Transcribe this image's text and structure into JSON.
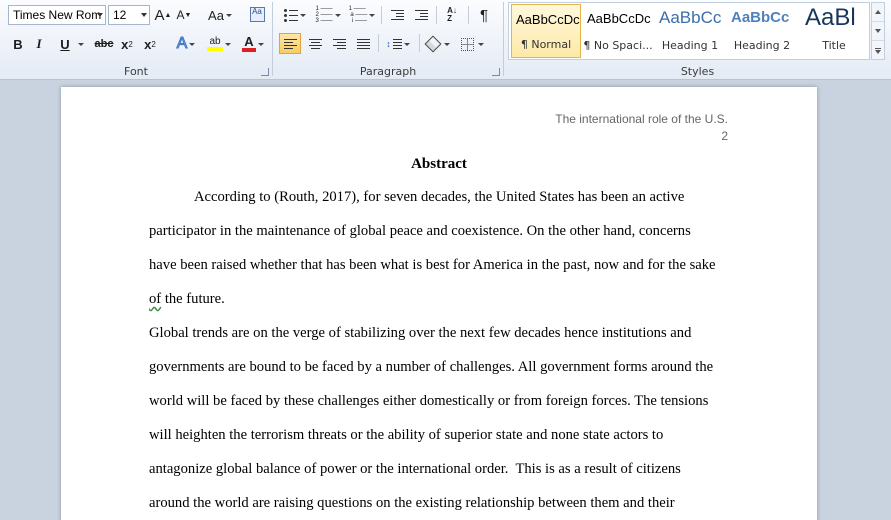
{
  "ribbon": {
    "font_group": {
      "label": "Font",
      "font_name": "Times New Rom",
      "font_size": "12",
      "grow_font": "A",
      "shrink_font": "A",
      "change_case": "Aa",
      "bold": "B",
      "italic": "I",
      "underline": "U",
      "strikethrough": "abc",
      "subscript": "x",
      "subscript_mark": "2",
      "superscript": "x",
      "superscript_mark": "2",
      "text_effects": "A",
      "highlight": "ab",
      "font_color": "A",
      "highlight_color": "#ffff00",
      "font_color_value": "#e02020"
    },
    "paragraph_group": {
      "label": "Paragraph",
      "pilcrow": "¶"
    },
    "styles_group": {
      "label": "Styles",
      "items": [
        {
          "sample": "AaBbCcDc",
          "name": "¶ Normal",
          "color": "#000000"
        },
        {
          "sample": "AaBbCcDc",
          "name": "¶ No Spaci...",
          "color": "#000000"
        },
        {
          "sample": "AaBbCc",
          "name": "Heading 1",
          "color": "#3a6ea8"
        },
        {
          "sample": "AaBbCc",
          "name": "Heading 2",
          "color": "#4f81bd"
        },
        {
          "sample": "AaBl",
          "name": "Title",
          "color": "#17365d"
        }
      ]
    }
  },
  "document": {
    "header": {
      "running_head": "The international role of the U.S.",
      "page_number": "2"
    },
    "title": "Abstract",
    "lines": [
      "According to (Routh, 2017), for seven decades, the United States has been an active",
      "participator in the maintenance of global peace and coexistence. On the other hand, concerns",
      "have been raised whether that has been what is best for America in the past, now and for the sake",
      "of the future.",
      "Global trends are on the verge of stabilizing over the next few decades hence institutions and",
      "governments are bound to be faced by a number of challenges. All government forms around the",
      "world will be faced by these challenges either domestically or from foreign forces. The tensions",
      "will heighten the terrorism threats or the ability of superior state and none state actors to",
      "antagonize global balance of power or the international order.  This is as a result of citizens",
      "around the world are raising questions on the existing relationship between them and their"
    ]
  }
}
